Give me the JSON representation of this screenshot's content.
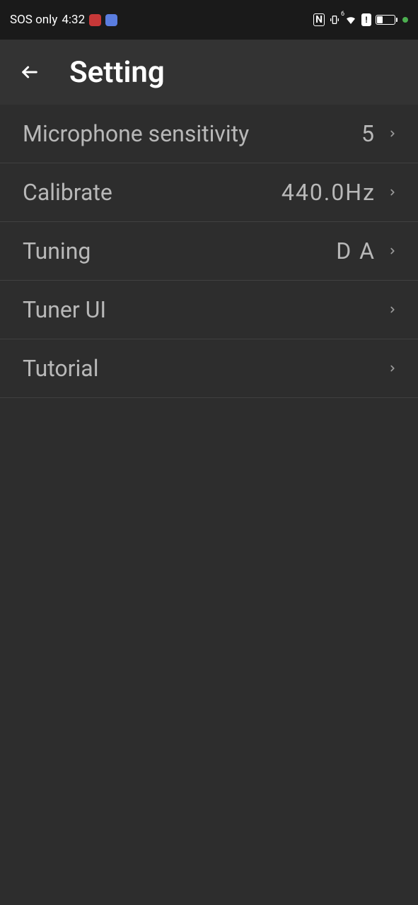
{
  "status_bar": {
    "network_text": "SOS only",
    "time": "4:32"
  },
  "header": {
    "title": "Setting"
  },
  "settings": [
    {
      "label": "Microphone sensitivity",
      "value": "5"
    },
    {
      "label": "Calibrate",
      "value": "440.0Hz"
    },
    {
      "label": "Tuning",
      "value": "D  A"
    },
    {
      "label": "Tuner UI",
      "value": ""
    },
    {
      "label": "Tutorial",
      "value": ""
    }
  ]
}
